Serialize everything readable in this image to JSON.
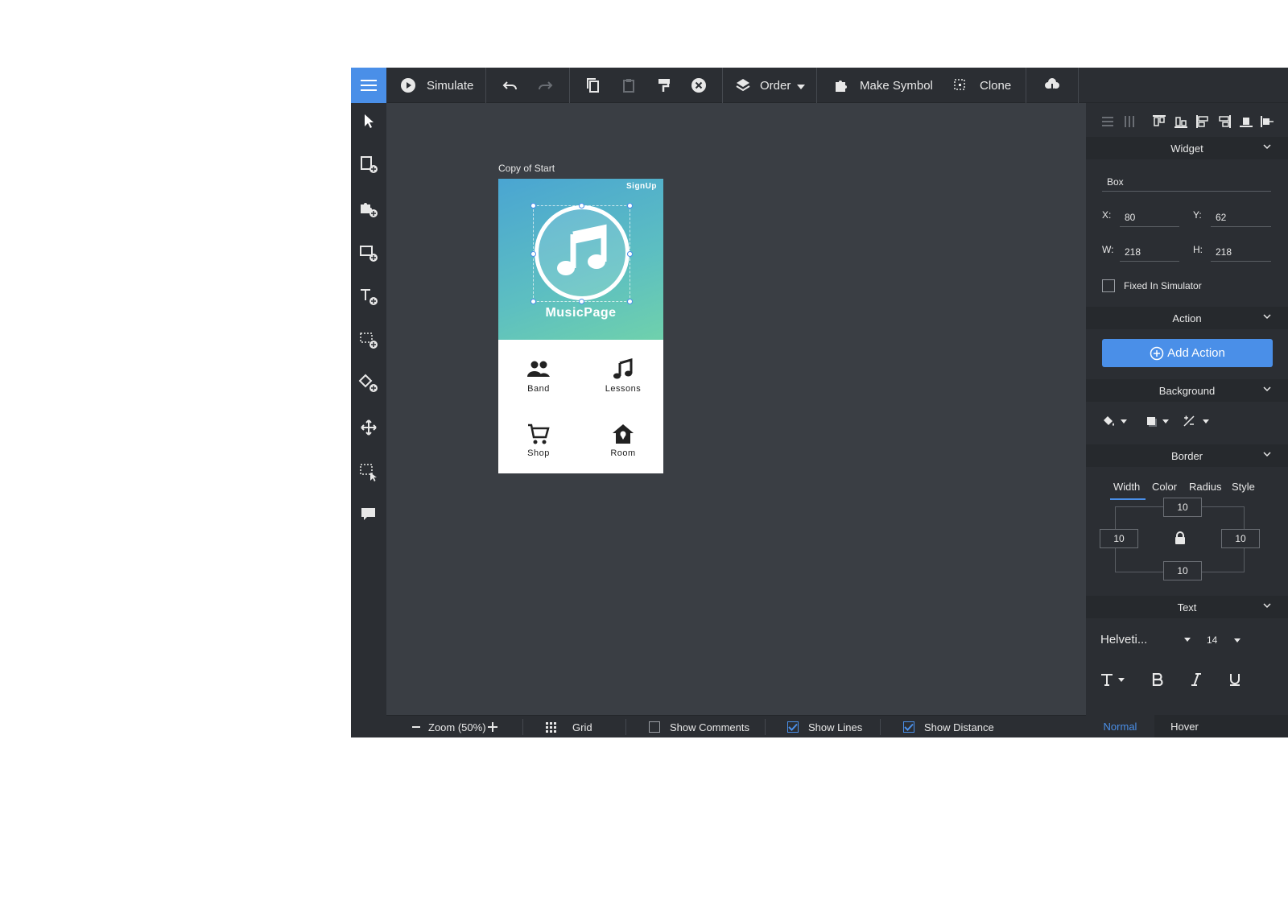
{
  "toolbar": {
    "simulate_label": "Simulate",
    "order_label": "Order",
    "make_symbol_label": "Make Symbol",
    "clone_label": "Clone"
  },
  "canvas": {
    "frame_title": "Copy of Start",
    "phone": {
      "signup": "SignUp",
      "app_name": "MusicPage",
      "items": [
        {
          "label": "Band",
          "icon": "people-icon"
        },
        {
          "label": "Lessons",
          "icon": "music-note-icon"
        },
        {
          "label": "Shop",
          "icon": "cart-icon"
        },
        {
          "label": "Room",
          "icon": "home-location-icon"
        }
      ]
    }
  },
  "bottom_bar": {
    "zoom_label": "Zoom (50%)",
    "grid_label": "Grid",
    "show_comments": {
      "label": "Show Comments",
      "checked": false
    },
    "show_lines": {
      "label": "Show Lines",
      "checked": true
    },
    "show_distance": {
      "label": "Show Distance",
      "checked": true
    }
  },
  "right_panel": {
    "widget": {
      "section": "Widget",
      "name": "Box",
      "x_label": "X:",
      "x": "80",
      "y_label": "Y:",
      "y": "62",
      "w_label": "W:",
      "w": "218",
      "h_label": "H:",
      "h": "218",
      "fixed_label": "Fixed In Simulator"
    },
    "action": {
      "section": "Action",
      "add_label": "Add Action"
    },
    "background": {
      "section": "Background"
    },
    "border": {
      "section": "Border",
      "tabs": [
        "Width",
        "Color",
        "Radius",
        "Style"
      ],
      "top": "10",
      "left": "10",
      "right": "10",
      "bottom": "10"
    },
    "text": {
      "section": "Text",
      "font": "Helveti...",
      "size": "14"
    },
    "states": {
      "normal": "Normal",
      "hover": "Hover"
    }
  },
  "colors": {
    "accent": "#4a8fe8",
    "panel": "#2b2e33",
    "canvas": "#3a3e44"
  }
}
